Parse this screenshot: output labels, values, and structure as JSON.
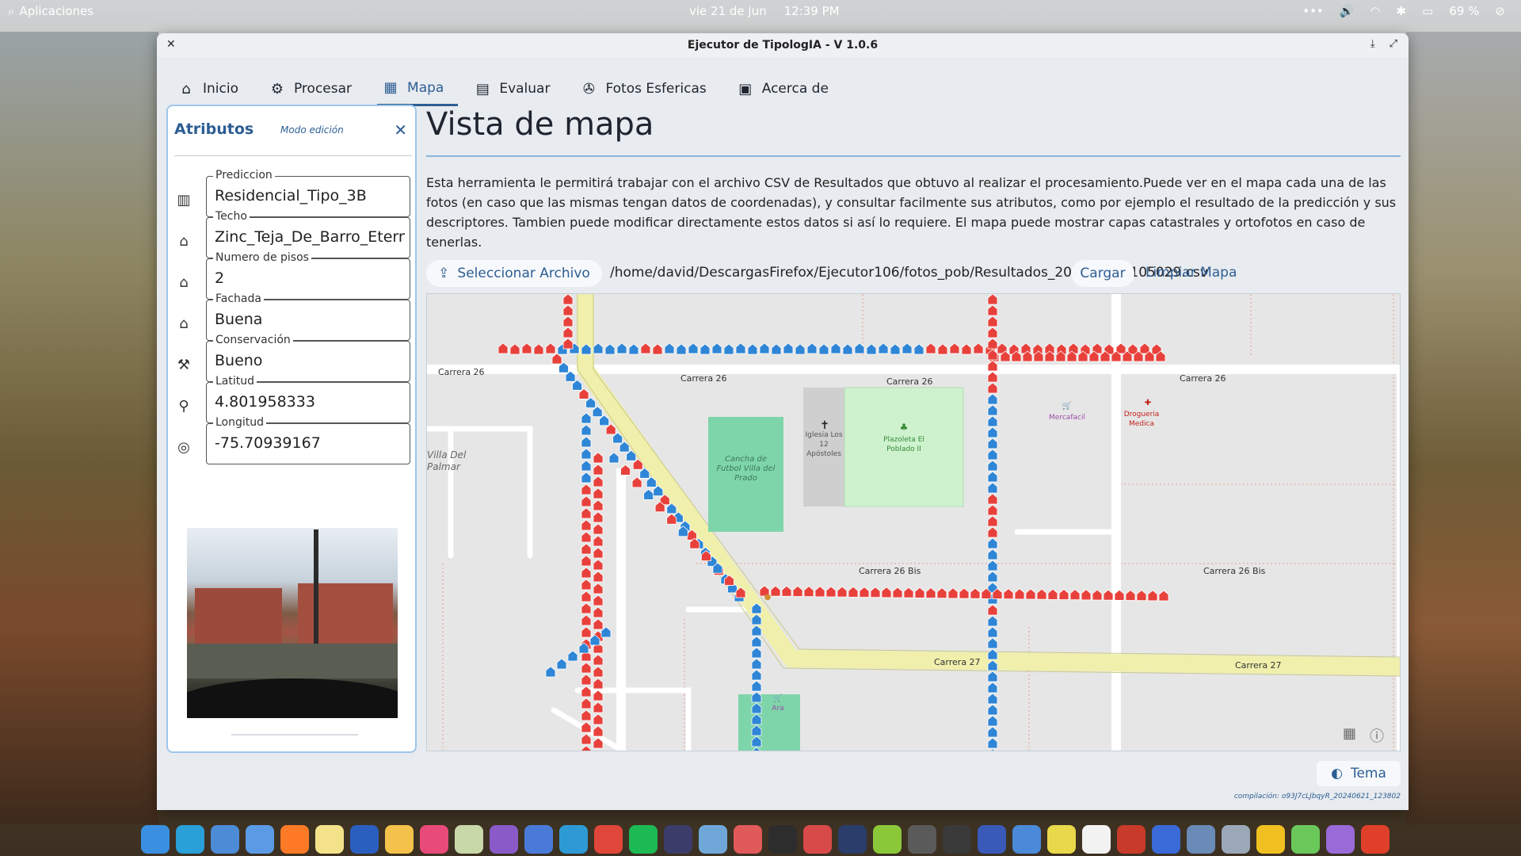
{
  "topbar": {
    "apps_label": "Aplicaciones",
    "date": "vie 21 de jun",
    "time": "12:39 PM",
    "battery": "69 %"
  },
  "window": {
    "title": "Ejecutor de TipologIA - V 1.0.6"
  },
  "nav": {
    "tabs": [
      {
        "label": "Inicio",
        "icon": "home-icon"
      },
      {
        "label": "Procesar",
        "icon": "brain-icon"
      },
      {
        "label": "Mapa",
        "icon": "map-icon",
        "active": true
      },
      {
        "label": "Evaluar",
        "icon": "chart-icon"
      },
      {
        "label": "Fotos Esfericas",
        "icon": "aperture-icon"
      },
      {
        "label": "Acerca de",
        "icon": "info-chart-icon"
      }
    ]
  },
  "panel": {
    "title": "Atributos",
    "mode": "Modo edición",
    "fields": [
      {
        "label": "Prediccion",
        "value": "Residencial_Tipo_3B",
        "icon": "chart-icon"
      },
      {
        "label": "Techo",
        "value": "Zinc_Teja_De_Barro_Eternit",
        "icon": "roof-icon"
      },
      {
        "label": "Numero de pisos",
        "value": "2",
        "icon": "house-icon"
      },
      {
        "label": "Fachada",
        "value": "Buena",
        "icon": "facade-icon"
      },
      {
        "label": "Conservación",
        "value": "Bueno",
        "icon": "maintenance-icon"
      },
      {
        "label": "Latitud",
        "value": "4.801958333",
        "icon": "pin-icon"
      },
      {
        "label": "Longitud",
        "value": "-75.70939167",
        "icon": "compass-icon"
      }
    ]
  },
  "main": {
    "title": "Vista de mapa",
    "description": "Esta herramienta le permitirá trabajar con el archivo CSV de Resultados que obtuvo al realizar el procesamiento.Puede ver en el mapa cada una de las fotos (en caso que las mismas tengan datos de coordenadas), y consultar facilmente sus atributos, como por ejemplo el resultado de la predicción y sus descriptores. Tambien puede modificar directamente estos datos si así lo requiere. El mapa puede mostrar capas catastrales y ortofotos en caso de tenerlas.",
    "select_file_label": "Seleccionar Archivo",
    "file_path": "/home/david/DescargasFirefox/Ejecutor106/fotos_pob/Resultados_20240629_105029.csv",
    "load_label": "Cargar",
    "clear_label": "Limpiar Mapa"
  },
  "map": {
    "street_labels": [
      "Carrera 26",
      "Carrera 26",
      "Carrera 26",
      "Carrera 26",
      "Carrera 26 Bis",
      "Carrera 26 Bis",
      "Carrera 27",
      "Carrera 27"
    ],
    "place_labels": {
      "neighborhood": "Villa Del Palmar",
      "field": "Cancha de Futbol Villa del Prado",
      "church": "Iglesia Los 12 Apóstoles",
      "plaza": "Plazoleta El Poblado II",
      "market": "Mercafacil",
      "pharmacy": "Drogueria Medica",
      "store": "Ara"
    },
    "marker_colors": {
      "red": "#e8413c",
      "blue": "#2f86d6"
    }
  },
  "footer": {
    "theme_label": "Tema",
    "build": "compilación: o93J7cLJbqyR_20240621_123802"
  }
}
